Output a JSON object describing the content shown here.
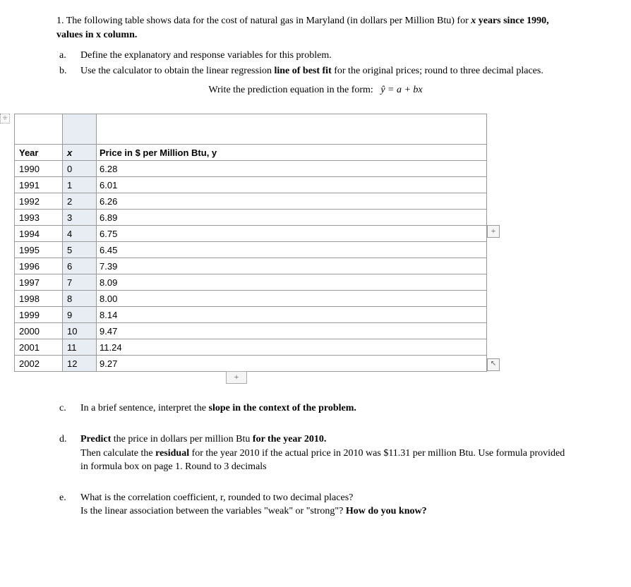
{
  "intro": {
    "line1_a": "1. The following table shows data for the cost of natural gas in Maryland (in dollars per Million Btu) for ",
    "line1_x": "x",
    "line1_b": " years since 1990, values in x column.",
    "a_letter": "a.",
    "a_text": "Define the explanatory and response variables for this problem.",
    "b_letter": "b.",
    "b_text_a": "Use the calculator to obtain the linear regression ",
    "b_bold": "line of best fit",
    "b_text_b": " for the original prices; round to three decimal places.",
    "eq_text": "Write the prediction equation in the form:",
    "eq_formula": "ŷ = a + bx"
  },
  "table": {
    "h_year": "Year",
    "h_x": "x",
    "h_price": "Price in $ per Million Btu, y",
    "rows": [
      {
        "year": "1990",
        "x": "0",
        "price": "6.28"
      },
      {
        "year": "1991",
        "x": "1",
        "price": "6.01"
      },
      {
        "year": "1992",
        "x": "2",
        "price": "6.26"
      },
      {
        "year": "1993",
        "x": "3",
        "price": "6.89"
      },
      {
        "year": "1994",
        "x": "4",
        "price": "6.75"
      },
      {
        "year": "1995",
        "x": "5",
        "price": "6.45"
      },
      {
        "year": "1996",
        "x": "6",
        "price": "7.39"
      },
      {
        "year": "1997",
        "x": "7",
        "price": "8.09"
      },
      {
        "year": "1998",
        "x": "8",
        "price": "8.00"
      },
      {
        "year": "1999",
        "x": "9",
        "price": "8.14"
      },
      {
        "year": "2000",
        "x": "10",
        "price": "9.47"
      },
      {
        "year": "2001",
        "x": "11",
        "price": "11.24"
      },
      {
        "year": "2002",
        "x": "12",
        "price": "9.27"
      }
    ]
  },
  "questions": {
    "c_letter": "c.",
    "c_text_a": "In a brief sentence, interpret the ",
    "c_bold": "slope in the context of the problem.",
    "d_letter": "d.",
    "d_bold1": "Predict",
    "d_text_a": " the price in dollars per million Btu ",
    "d_bold2": "for the year 2010.",
    "d_line2_a": "Then calculate the ",
    "d_bold3": "residual",
    "d_line2_b": " for the year 2010 if the actual price in 2010 was $11.31 per million Btu.  Use formula provided in formula box on page 1. Round to 3 decimals",
    "e_letter": "e.",
    "e_line1": "What is the correlation coefficient, r,  rounded to two decimal places?",
    "e_line2_a": "Is the linear association between the variables \"weak\" or \"strong\"?  ",
    "e_bold": "How do you know?"
  },
  "ui": {
    "plus": "+",
    "handle": "⁜",
    "corner": "↖"
  }
}
